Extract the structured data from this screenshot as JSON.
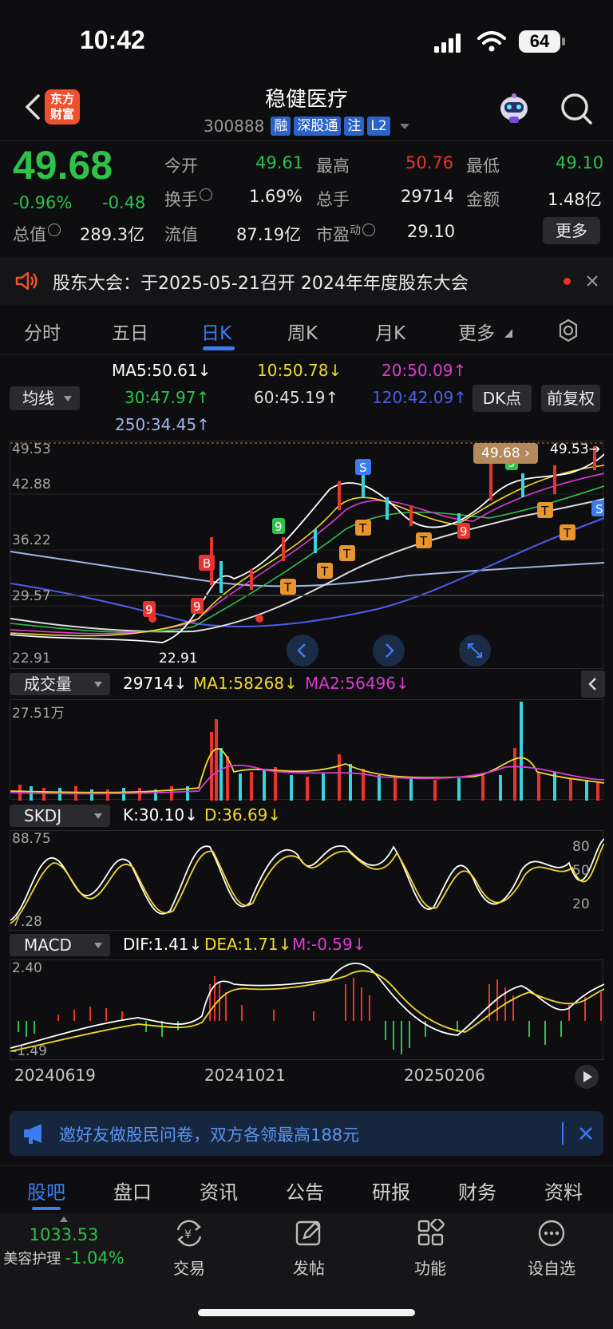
{
  "status_bar": {
    "time": "10:42",
    "battery": "64"
  },
  "header": {
    "logo": "东方财富",
    "title": "稳健医疗",
    "code": "300888",
    "tags": [
      "融",
      "深股通",
      "注",
      "L2"
    ]
  },
  "quote": {
    "price": "49.68",
    "change_pct": "-0.96%",
    "change": "-0.48",
    "fields": {
      "open_label": "今开",
      "open": "49.61",
      "high_label": "最高",
      "high": "50.76",
      "low_label": "最低",
      "low": "49.10",
      "turnover_label": "换手",
      "turnover": "1.69%",
      "volume_label": "总手",
      "volume": "29714",
      "amount_label": "金额",
      "amount": "1.48亿",
      "mktcap_label": "总值",
      "mktcap": "289.3亿",
      "float_label": "流值",
      "float": "87.19亿",
      "pe_label": "市盈",
      "pe_sup": "动",
      "pe": "29.10"
    },
    "more": "更多"
  },
  "notice": {
    "text": "股东大会：于2025-05-21召开 2024年年度股东大会"
  },
  "period_tabs": [
    "分时",
    "五日",
    "日K",
    "周K",
    "月K",
    "更多"
  ],
  "active_period": "日K",
  "ma": {
    "selector": "均线",
    "ma5": "MA5:50.61↓",
    "ma10": "10:50.78↓",
    "ma20": "20:50.09↑",
    "ma30": "30:47.97↑",
    "ma60": "60:45.19↑",
    "ma120": "120:42.09↑",
    "ma250": "250:34.45↑",
    "dk_button": "DK点",
    "adjust_button": "前复权",
    "colors": {
      "ma5": "#ffffff",
      "ma10": "#f2d92e",
      "ma20": "#d93dd1",
      "ma30": "#2ec24a",
      "ma60": "#dddddd",
      "ma120": "#4b5ee8",
      "ma250": "#9fb6e8"
    }
  },
  "kline": {
    "y_labels": [
      "49.53",
      "42.88",
      "36.22",
      "29.57",
      "22.91"
    ],
    "last_price_tag": "49.68",
    "high_tag": "49.53",
    "low_tag": "22.91"
  },
  "volume_panel": {
    "selector": "成交量",
    "vol": "29714↓",
    "ma1": "MA1:58268↓",
    "ma2": "MA2:56496↓",
    "y_top": "27.51万"
  },
  "skdj_panel": {
    "selector": "SKDJ",
    "k": "K:30.10↓",
    "d": "D:36.69↓",
    "y_labels": [
      "88.75",
      "80",
      "50",
      "20",
      "7.28"
    ]
  },
  "macd_panel": {
    "selector": "MACD",
    "dif": "DIF:1.41↓",
    "dea": "DEA:1.71↓",
    "m": "M:-0.59↓",
    "y_labels": [
      "2.40",
      "-1.49"
    ]
  },
  "x_dates": [
    "20240619",
    "20241021",
    "20250206"
  ],
  "ad": {
    "text": "邀好友做股民问卷，双方各领最高188元"
  },
  "bottom_tabs": [
    "股吧",
    "盘口",
    "资讯",
    "公告",
    "研报",
    "财务",
    "资料"
  ],
  "active_bottom_tab": "股吧",
  "dock": {
    "index_value": "1033.53",
    "index_name": "美容护理",
    "index_change": "-1.04%",
    "items": [
      "交易",
      "发帖",
      "功能",
      "设自选"
    ]
  }
}
